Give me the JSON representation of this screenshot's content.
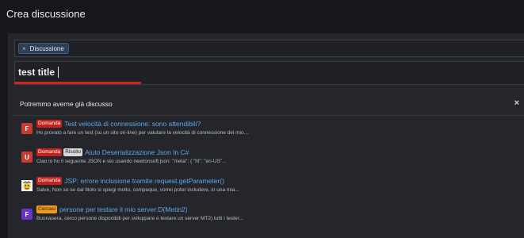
{
  "page": {
    "title": "Crea discussione"
  },
  "prefix": {
    "remove_symbol": "×",
    "label": "Discussione"
  },
  "thread_title": {
    "value": "test title"
  },
  "suggestions": {
    "heading": "Potremmo averne già discusso",
    "close_symbol": "×",
    "colors": {
      "link": "#5ea7ea",
      "badge_domanda": "#c8211c",
      "badge_risolto": "#d8d8d8",
      "badge_cercasi": "#f29b13",
      "accent_underline": "#d4221e"
    },
    "items": [
      {
        "avatar_letter": "F",
        "avatar_color": "#c93a34",
        "badges": [
          "Domanda"
        ],
        "title": "Test velocità di connessione: sono attendibili?",
        "snippet": "Ho provato a fare un test (su un sito on-line) per valutare la velocità di connessione del mio..."
      },
      {
        "avatar_letter": "U",
        "avatar_color": "#c93a34",
        "badges": [
          "Domanda",
          "Risolto"
        ],
        "title": "Aiuto Deserializzazione Json In C#",
        "snippet": "Ciao io ho il seguente JSON e sto usando newtonsoft.json: \"meta\": { \"hl\": \"en-US\"..."
      },
      {
        "avatar_letter": "",
        "avatar_color": "#e8e8e8",
        "avatar_icon": "cartoon-face-icon",
        "badges": [
          "Domanda"
        ],
        "title": "JSP: errore inclusione tramite request.getParameter()",
        "snippet": "Salve, Non so se dal titolo si spiegi molto, compuque, vorrei poter includere, in una mia..."
      },
      {
        "avatar_letter": "F",
        "avatar_color": "#6b32c8",
        "badges": [
          "Cercasi"
        ],
        "title": "persone per testare il mio server:D(Metin2)",
        "snippet": "Buonasera, cerco persone disponibili per sviluppare e testare un server MT2) tutti i tester..."
      }
    ]
  }
}
